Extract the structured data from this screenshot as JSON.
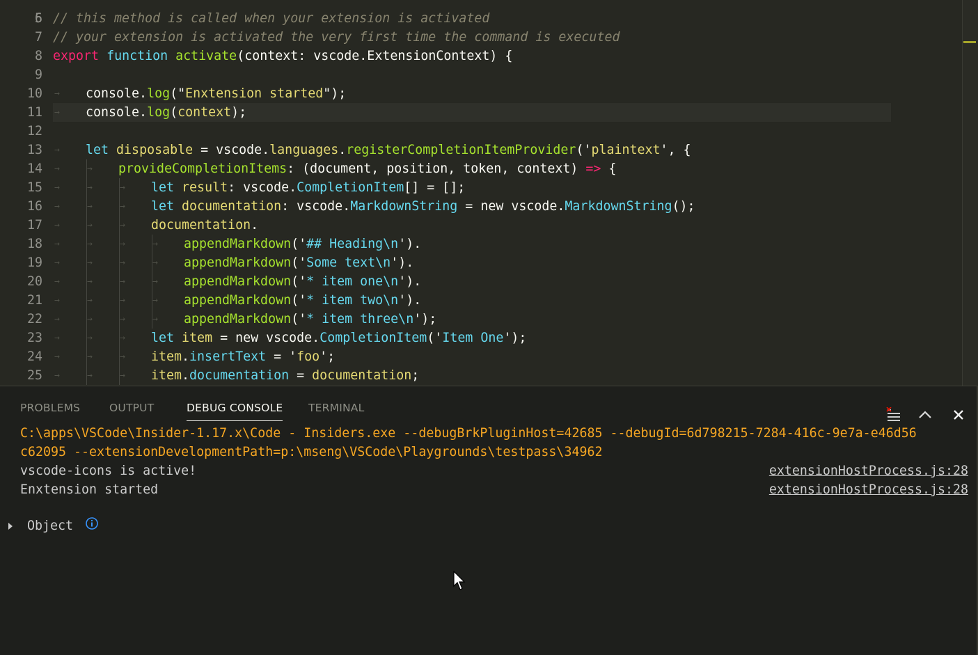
{
  "editor": {
    "top_partial_line_number": "5",
    "lines": [
      {
        "n": "6",
        "indent": 0,
        "tokens": [
          [
            "t-cmt",
            "// this method is called when your extension is activated"
          ]
        ]
      },
      {
        "n": "7",
        "indent": 0,
        "tokens": [
          [
            "t-cmt",
            "// your extension is activated the very first time the command is executed"
          ]
        ]
      },
      {
        "n": "8",
        "indent": 0,
        "tokens": [
          [
            "t-kw",
            "export"
          ],
          [
            "t-pl",
            " "
          ],
          [
            "t-st",
            "function"
          ],
          [
            "t-pl",
            " "
          ],
          [
            "t-fn",
            "activate"
          ],
          [
            "t-pl",
            "(context: vscode.ExtensionContext) {"
          ]
        ]
      },
      {
        "n": "9",
        "indent": 0,
        "tokens": []
      },
      {
        "n": "10",
        "indent": 1,
        "tokens": [
          [
            "t-pl",
            "console."
          ],
          [
            "t-fn",
            "log"
          ],
          [
            "t-pl",
            "(\""
          ],
          [
            "t-str",
            "Enxtension started"
          ],
          [
            "t-pl",
            "\");"
          ]
        ]
      },
      {
        "n": "11",
        "indent": 1,
        "current": true,
        "tokens": [
          [
            "t-pl",
            "console."
          ],
          [
            "t-fn",
            "log"
          ],
          [
            "t-pl",
            "("
          ],
          [
            "t-str",
            "context"
          ],
          [
            "t-pl",
            ");"
          ]
        ]
      },
      {
        "n": "12",
        "indent": 0,
        "tokens": []
      },
      {
        "n": "13",
        "indent": 1,
        "tokens": [
          [
            "t-st",
            "let"
          ],
          [
            "t-pl",
            " "
          ],
          [
            "t-str",
            "disposable"
          ],
          [
            "t-pl",
            " = vscode."
          ],
          [
            "t-str",
            "languages"
          ],
          [
            "t-pl",
            "."
          ],
          [
            "t-fn",
            "registerCompletionItemProvider"
          ],
          [
            "t-pl",
            "('"
          ],
          [
            "t-str",
            "plaintext"
          ],
          [
            "t-pl",
            "', {"
          ]
        ]
      },
      {
        "n": "14",
        "indent": 2,
        "tokens": [
          [
            "t-fn",
            "provideCompletionItems"
          ],
          [
            "t-pl",
            ": (document, position, token, context) "
          ],
          [
            "t-kw",
            "=>"
          ],
          [
            "t-pl",
            " {"
          ]
        ]
      },
      {
        "n": "15",
        "indent": 3,
        "tokens": [
          [
            "t-st",
            "let"
          ],
          [
            "t-pl",
            " "
          ],
          [
            "t-str",
            "result"
          ],
          [
            "t-pl",
            ": vscode."
          ],
          [
            "t-st",
            "CompletionItem"
          ],
          [
            "t-pl",
            "[] = [];"
          ]
        ]
      },
      {
        "n": "16",
        "indent": 3,
        "tokens": [
          [
            "t-st",
            "let"
          ],
          [
            "t-pl",
            " "
          ],
          [
            "t-str",
            "documentation"
          ],
          [
            "t-pl",
            ": vscode."
          ],
          [
            "t-st",
            "MarkdownString"
          ],
          [
            "t-pl",
            " = "
          ],
          [
            "t-pl",
            "new"
          ],
          [
            "t-pl",
            " vscode."
          ],
          [
            "t-st",
            "MarkdownString"
          ],
          [
            "t-pl",
            "();"
          ]
        ]
      },
      {
        "n": "17",
        "indent": 3,
        "tokens": [
          [
            "t-str",
            "documentation"
          ],
          [
            "t-pl",
            "."
          ]
        ]
      },
      {
        "n": "18",
        "indent": 4,
        "tokens": [
          [
            "t-fn",
            "appendMarkdown"
          ],
          [
            "t-pl",
            "('"
          ],
          [
            "t-st",
            "## Heading\\n"
          ],
          [
            "t-pl",
            "')."
          ]
        ]
      },
      {
        "n": "19",
        "indent": 4,
        "tokens": [
          [
            "t-fn",
            "appendMarkdown"
          ],
          [
            "t-pl",
            "('"
          ],
          [
            "t-st",
            "Some text\\n"
          ],
          [
            "t-pl",
            "')."
          ]
        ]
      },
      {
        "n": "20",
        "indent": 4,
        "tokens": [
          [
            "t-fn",
            "appendMarkdown"
          ],
          [
            "t-pl",
            "('"
          ],
          [
            "t-st",
            "* item one\\n"
          ],
          [
            "t-pl",
            "')."
          ]
        ]
      },
      {
        "n": "21",
        "indent": 4,
        "tokens": [
          [
            "t-fn",
            "appendMarkdown"
          ],
          [
            "t-pl",
            "('"
          ],
          [
            "t-st",
            "* item two\\n"
          ],
          [
            "t-pl",
            "')."
          ]
        ]
      },
      {
        "n": "22",
        "indent": 4,
        "tokens": [
          [
            "t-fn",
            "appendMarkdown"
          ],
          [
            "t-pl",
            "('"
          ],
          [
            "t-st",
            "* item three\\n"
          ],
          [
            "t-pl",
            "');"
          ]
        ]
      },
      {
        "n": "23",
        "indent": 3,
        "tokens": [
          [
            "t-st",
            "let"
          ],
          [
            "t-pl",
            " "
          ],
          [
            "t-str",
            "item"
          ],
          [
            "t-pl",
            " = "
          ],
          [
            "t-pl",
            "new"
          ],
          [
            "t-pl",
            " vscode."
          ],
          [
            "t-st",
            "CompletionItem"
          ],
          [
            "t-pl",
            "('"
          ],
          [
            "t-st",
            "Item One"
          ],
          [
            "t-pl",
            "');"
          ]
        ]
      },
      {
        "n": "24",
        "indent": 3,
        "tokens": [
          [
            "t-str",
            "item"
          ],
          [
            "t-pl",
            "."
          ],
          [
            "t-st",
            "insertText"
          ],
          [
            "t-pl",
            " = '"
          ],
          [
            "t-str",
            "foo"
          ],
          [
            "t-pl",
            "';"
          ]
        ]
      },
      {
        "n": "25",
        "indent": 3,
        "tokens": [
          [
            "t-str",
            "item"
          ],
          [
            "t-pl",
            "."
          ],
          [
            "t-st",
            "documentation"
          ],
          [
            "t-pl",
            " = "
          ],
          [
            "t-str",
            "documentation"
          ],
          [
            "t-pl",
            ";"
          ]
        ]
      }
    ]
  },
  "panel": {
    "tabs": [
      {
        "label": "PROBLEMS",
        "active": false
      },
      {
        "label": "OUTPUT",
        "active": false
      },
      {
        "label": "DEBUG CONSOLE",
        "active": true
      },
      {
        "label": "TERMINAL",
        "active": false
      }
    ],
    "icons": [
      "clear-console-icon",
      "maximize-panel-icon",
      "close-panel-icon"
    ],
    "console": {
      "command_line_1": "C:\\apps\\VSCode\\Insider-1.17.x\\Code - Insiders.exe --debugBrkPluginHost=42685 --debugId=6d798215-7284-416c-9e7a-e46d56",
      "command_line_2": "c62095 --extensionDevelopmentPath=p:\\mseng\\VSCode\\Playgrounds\\testpass\\34962",
      "log_1_text": "vscode-icons is active!",
      "log_1_source": "extensionHostProcess.js:28",
      "log_2_text": "Enxtension started",
      "log_2_source": "extensionHostProcess.js:28",
      "object_label": "Object",
      "info_icon": "info-icon",
      "expand_icon": "chevron-right-icon"
    }
  },
  "colors": {
    "editor_bg": "#272822",
    "panel_bg": "#1e1f1c",
    "command_text": "#f5a623"
  }
}
